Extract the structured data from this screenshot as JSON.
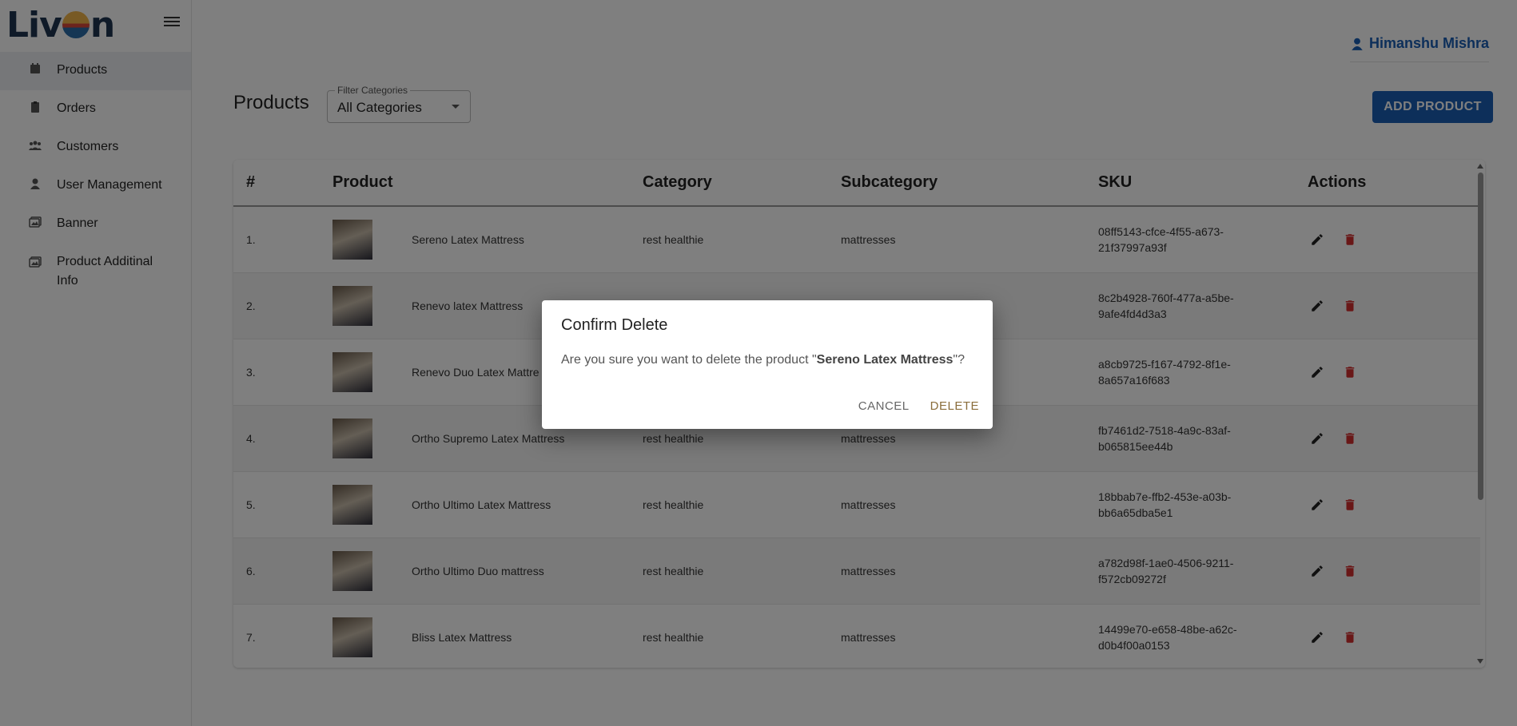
{
  "brand": {
    "logo_left": "Liv",
    "logo_right": "n",
    "accent": "#1a5fb4"
  },
  "sidebar": {
    "items": [
      {
        "label": "Products",
        "icon": "calendar-icon",
        "active": true
      },
      {
        "label": "Orders",
        "icon": "clipboard-icon"
      },
      {
        "label": "Customers",
        "icon": "people-icon"
      },
      {
        "label": "User Management",
        "icon": "person-icon"
      },
      {
        "label": "Banner",
        "icon": "image-icon"
      },
      {
        "label": "Product Additinal Info",
        "icon": "image-icon"
      }
    ]
  },
  "header": {
    "user_name": "Himanshu Mishra"
  },
  "page": {
    "title": "Products",
    "filter": {
      "legend": "Filter Categories",
      "value": "All Categories"
    },
    "add_button": "ADD PRODUCT"
  },
  "table": {
    "columns": [
      "#",
      "Product",
      "Category",
      "Subcategory",
      "SKU",
      "Actions"
    ],
    "rows": [
      {
        "num": "1.",
        "product": "Sereno Latex Mattress",
        "category": "rest healthie",
        "subcategory": "mattresses",
        "sku_1": "08ff5143-cfce-4f55-a673-",
        "sku_2": "21f37997a93f"
      },
      {
        "num": "2.",
        "product": "Renevo latex Mattress",
        "category": "",
        "subcategory": "",
        "sku_1": "8c2b4928-760f-477a-a5be-",
        "sku_2": "9afe4fd4d3a3"
      },
      {
        "num": "3.",
        "product": "Renevo Duo Latex Mattre",
        "category": "",
        "subcategory": "",
        "sku_1": "a8cb9725-f167-4792-8f1e-",
        "sku_2": "8a657a16f683"
      },
      {
        "num": "4.",
        "product": "Ortho Supremo Latex Mattress",
        "category": "rest healthie",
        "subcategory": "mattresses",
        "sku_1": "fb7461d2-7518-4a9c-83af-",
        "sku_2": "b065815ee44b"
      },
      {
        "num": "5.",
        "product": "Ortho Ultimo Latex Mattress",
        "category": "rest healthie",
        "subcategory": "mattresses",
        "sku_1": "18bbab7e-ffb2-453e-a03b-",
        "sku_2": "bb6a65dba5e1"
      },
      {
        "num": "6.",
        "product": "Ortho Ultimo Duo mattress",
        "category": "rest healthie",
        "subcategory": "mattresses",
        "sku_1": "a782d98f-1ae0-4506-9211-",
        "sku_2": "f572cb09272f"
      },
      {
        "num": "7.",
        "product": "Bliss Latex Mattress",
        "category": "rest healthie",
        "subcategory": "mattresses",
        "sku_1": "14499e70-e658-48be-a62c-",
        "sku_2": "d0b4f00a0153"
      }
    ]
  },
  "dialog": {
    "title": "Confirm Delete",
    "message_prefix": "Are you sure you want to delete the product \"",
    "product": "Sereno Latex Mattress",
    "message_suffix": "\"?",
    "cancel": "CANCEL",
    "delete": "DELETE"
  }
}
